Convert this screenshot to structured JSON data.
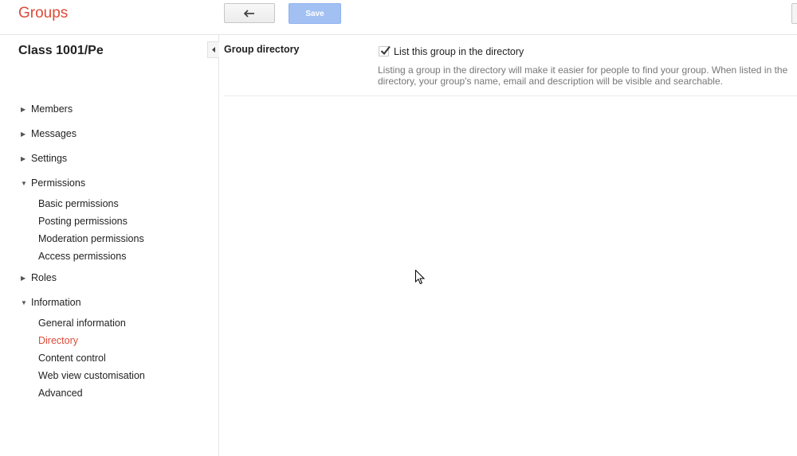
{
  "header": {
    "app_title": "Groups",
    "save_label": "Save",
    "back_icon": "back-arrow-icon"
  },
  "sidebar": {
    "group_name": "Class 1001/Pe",
    "sections": [
      {
        "label": "Members",
        "expanded": false
      },
      {
        "label": "Messages",
        "expanded": false
      },
      {
        "label": "Settings",
        "expanded": false
      },
      {
        "label": "Permissions",
        "expanded": true,
        "items": [
          "Basic permissions",
          "Posting permissions",
          "Moderation permissions",
          "Access permissions"
        ]
      },
      {
        "label": "Roles",
        "expanded": false
      },
      {
        "label": "Information",
        "expanded": true,
        "items": [
          "General information",
          "Directory",
          "Content control",
          "Web view customisation",
          "Advanced"
        ]
      }
    ],
    "active_item": "Directory"
  },
  "main": {
    "section_title": "Group directory",
    "checkbox_label": "List this group in the directory",
    "checkbox_checked": true,
    "description": "Listing a group in the directory will make it easier for people to find your group. When listed in the directory, your group's name, email and description will be visible and searchable."
  },
  "colors": {
    "brand_red": "#dd4b39",
    "save_blue_disabled": "#a3c0f2",
    "description_gray": "#777777"
  }
}
